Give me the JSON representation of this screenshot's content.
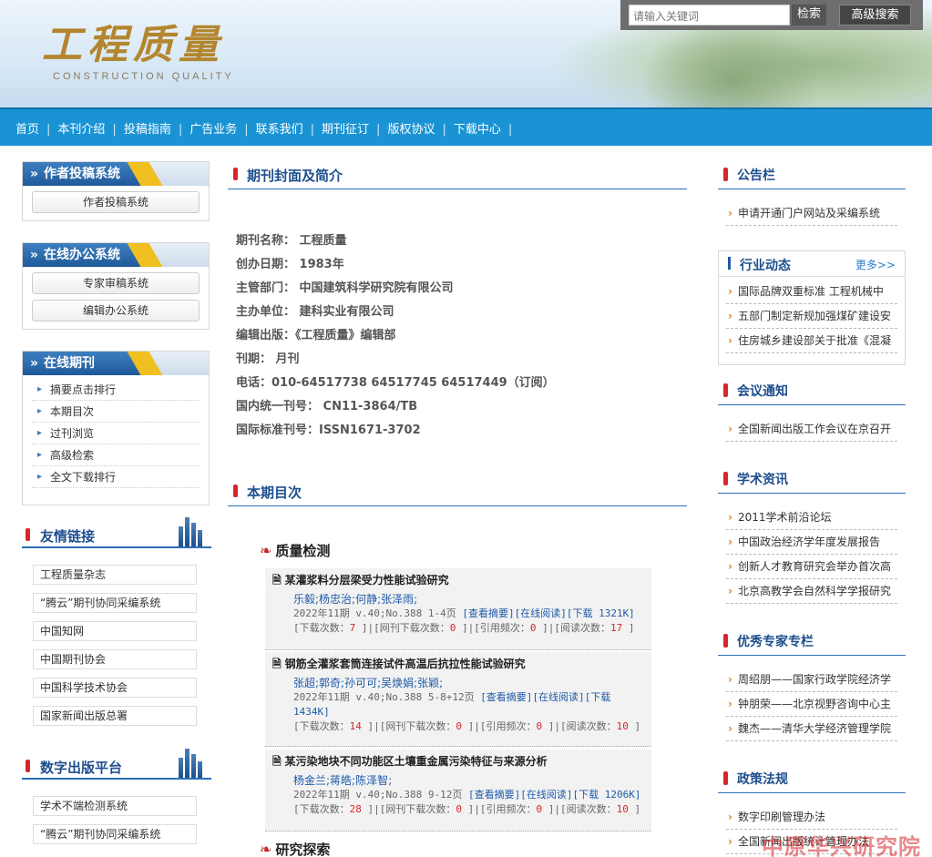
{
  "header": {
    "logo_cn": "工程质量",
    "logo_en": "CONSTRUCTION  QUALITY",
    "search_placeholder": "请输入关键词",
    "search_button": "检索",
    "advanced_search_button": "高级搜索"
  },
  "nav": {
    "items": [
      "首页",
      "本刊介绍",
      "投稿指南",
      "广告业务",
      "联系我们",
      "期刊征订",
      "版权协议",
      "下载中心"
    ]
  },
  "left": {
    "author_box": {
      "title": "作者投稿系统",
      "buttons": [
        "作者投稿系统"
      ]
    },
    "office_box": {
      "title": "在线办公系统",
      "buttons": [
        "专家审稿系统",
        "编辑办公系统"
      ]
    },
    "journal_box": {
      "title": "在线期刊",
      "items": [
        "摘要点击排行",
        "本期目次",
        "过刊浏览",
        "高级检索",
        "全文下载排行"
      ]
    },
    "links": {
      "title": "友情链接",
      "items": [
        "工程质量杂志",
        "“腾云”期刊协同采编系统",
        "中国知网",
        "中国期刊协会",
        "中国科学技术协会",
        "国家新闻出版总署"
      ]
    },
    "digital": {
      "title": "数字出版平台",
      "items": [
        "学术不端检测系统",
        "“腾云”期刊协同采编系统"
      ]
    }
  },
  "center": {
    "cover_title": "期刊封面及简介",
    "info": [
      "期刊名称： 工程质量",
      "创办日期： 1983年",
      "主管部门： 中国建筑科学研究院有限公司",
      "主办单位： 建科实业有限公司",
      "编辑出版：《工程质量》编辑部",
      "刊期： 月刊",
      "电话：010-64517738 64517745  64517449（订阅）",
      "国内统一刊号： CN11-3864/TB",
      "国际标准刊号：ISSN1671-3702"
    ],
    "toc_title": "本期目次",
    "category1": "质量检测",
    "category2": "研究探索",
    "articles": [
      {
        "title": "某灌浆料分层梁受力性能试验研究",
        "authors": "乐毅;杨忠治;何静;张泽雨;",
        "meta1": "2022年11期 v.40;No.388 1-4页 ",
        "abs": "[查看摘要]",
        "read": "[在线阅读]",
        "dl": "[下载 1321K]",
        "dl_label": "[下载次数：",
        "dl_count": "7",
        "net_label": " ]|[网刊下载次数：",
        "net_count": "0",
        "cite_label": " ]|[引用频次：",
        "cite_count": "0",
        "read_label": " ]|[阅读次数：",
        "read_count": "17",
        "end": " ]"
      },
      {
        "title": "钢筋全灌浆套筒连接试件高温后抗拉性能试验研究",
        "authors": "张超;郭奇;孙可可;吴焕娟;张颖;",
        "meta1": "2022年11期 v.40;No.388 5-8+12页 ",
        "abs": "[查看摘要]",
        "read": "[在线阅读]",
        "dl": "[下载 1434K]",
        "dl_label": "[下载次数：",
        "dl_count": "14",
        "net_label": " ]|[网刊下载次数：",
        "net_count": "0",
        "cite_label": " ]|[引用频次：",
        "cite_count": "0",
        "read_label": " ]|[阅读次数：",
        "read_count": "10",
        "end": " ]"
      },
      {
        "title": "某污染地块不同功能区土壤重金属污染特征与来源分析",
        "authors": "杨金兰;蒋皓;陈泽智;",
        "meta1": "2022年11期 v.40;No.388 9-12页 ",
        "abs": "[查看摘要]",
        "read": "[在线阅读]",
        "dl": "[下载 1206K]",
        "dl_label": "[下载次数：",
        "dl_count": "28",
        "net_label": " ]|[网刊下载次数：",
        "net_count": "0",
        "cite_label": " ]|[引用频次：",
        "cite_count": "0",
        "read_label": " ]|[阅读次数：",
        "read_count": "10",
        "end": " ]"
      }
    ]
  },
  "right": {
    "notice": {
      "title": "公告栏",
      "items": [
        "申请开通门户网站及采编系统"
      ]
    },
    "industry": {
      "title": "行业动态",
      "more": "更多>>",
      "items": [
        "国际品牌双重标准 工程机械中",
        "五部门制定新规加强煤矿建设安",
        "住房城乡建设部关于批准《混凝"
      ]
    },
    "meeting": {
      "title": "会议通知",
      "items": [
        "全国新闻出版工作会议在京召开"
      ]
    },
    "academic": {
      "title": "学术资讯",
      "items": [
        "2011学术前沿论坛",
        "中国政治经济学年度发展报告",
        "创新人才教育研究会举办首次高",
        "北京高教学会自然科学学报研究"
      ]
    },
    "experts": {
      "title": "优秀专家专栏",
      "items": [
        "周绍朋——国家行政学院经济学",
        "钟朋荣——北京视野咨询中心主",
        "魏杰——清华大学经济管理学院"
      ]
    },
    "policy": {
      "title": "政策法规",
      "items": [
        "数字印刷管理办法",
        "全国新闻出版统计管理办法"
      ]
    }
  },
  "watermark": "中原华兴研究院"
}
